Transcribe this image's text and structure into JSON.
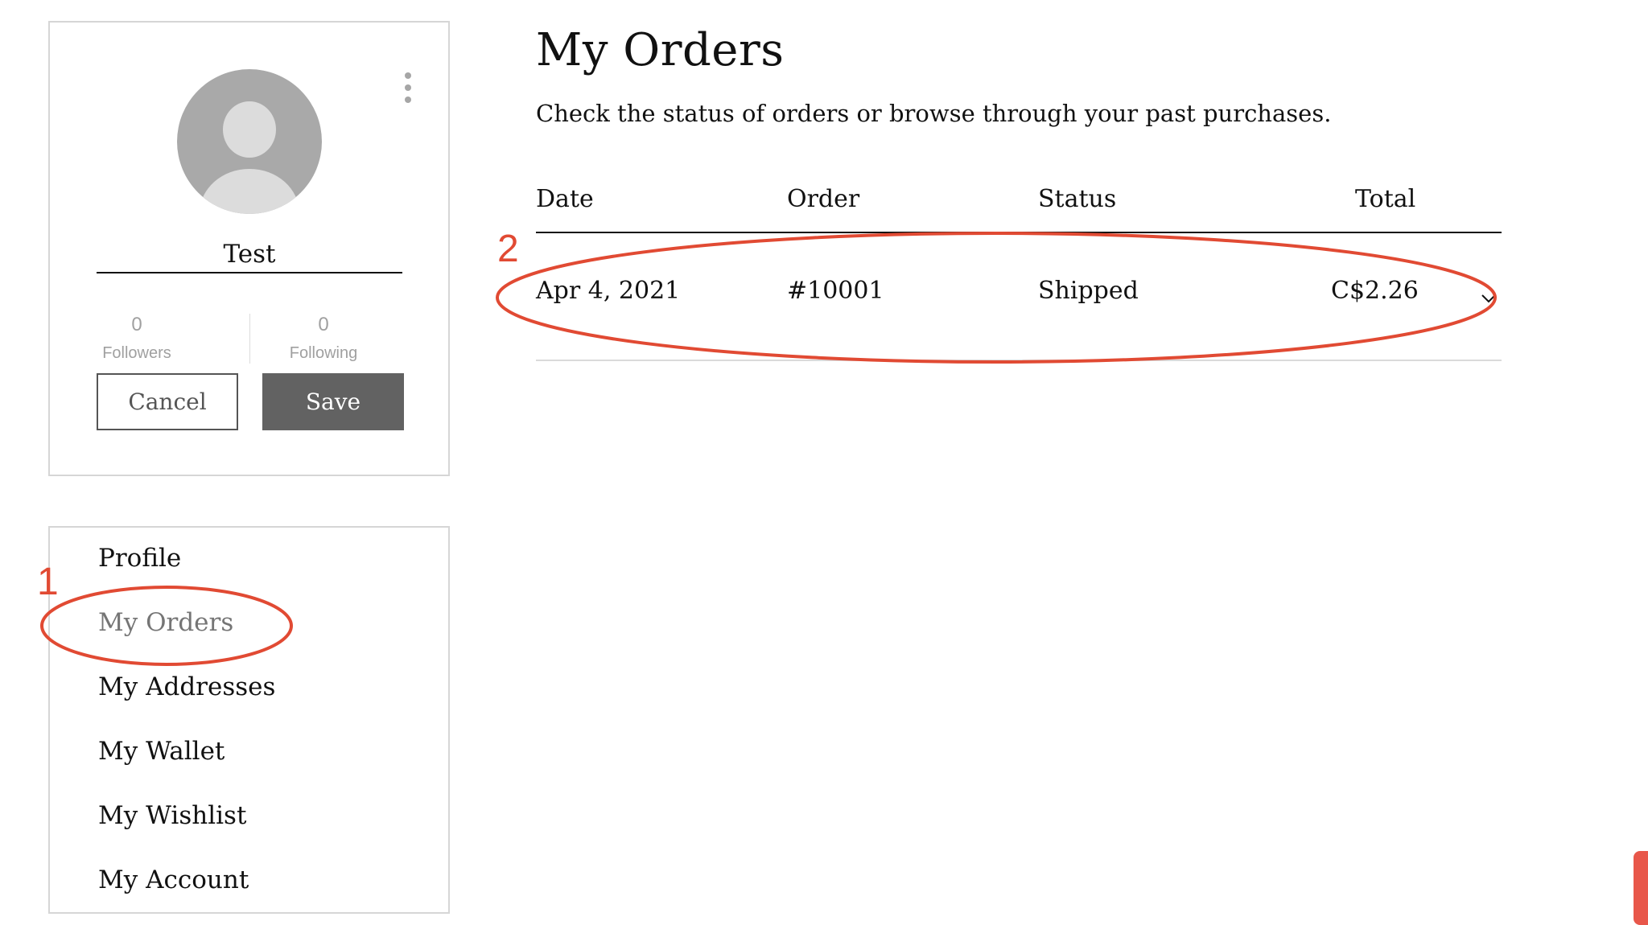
{
  "profile": {
    "username": "Test",
    "followers": {
      "count": "0",
      "label": "Followers"
    },
    "following": {
      "count": "0",
      "label": "Following"
    },
    "cancel_label": "Cancel",
    "save_label": "Save"
  },
  "nav": {
    "items": [
      {
        "label": "Profile"
      },
      {
        "label": "My Orders",
        "active": true
      },
      {
        "label": "My Addresses"
      },
      {
        "label": "My Wallet"
      },
      {
        "label": "My Wishlist"
      },
      {
        "label": "My Account"
      }
    ]
  },
  "orders": {
    "title": "My Orders",
    "subtitle": "Check the status of orders or browse through your past purchases.",
    "columns": [
      "Date",
      "Order",
      "Status",
      "Total"
    ],
    "rows": [
      {
        "date": "Apr 4, 2021",
        "order": "#10001",
        "status": "Shipped",
        "total": "C$2.26"
      }
    ]
  },
  "annotations": [
    {
      "label": "1",
      "color": "#e14a33"
    },
    {
      "label": "2",
      "color": "#e14a33"
    }
  ],
  "icons": [
    "more-vertical-icon",
    "avatar-icon",
    "chevron-down-icon"
  ]
}
